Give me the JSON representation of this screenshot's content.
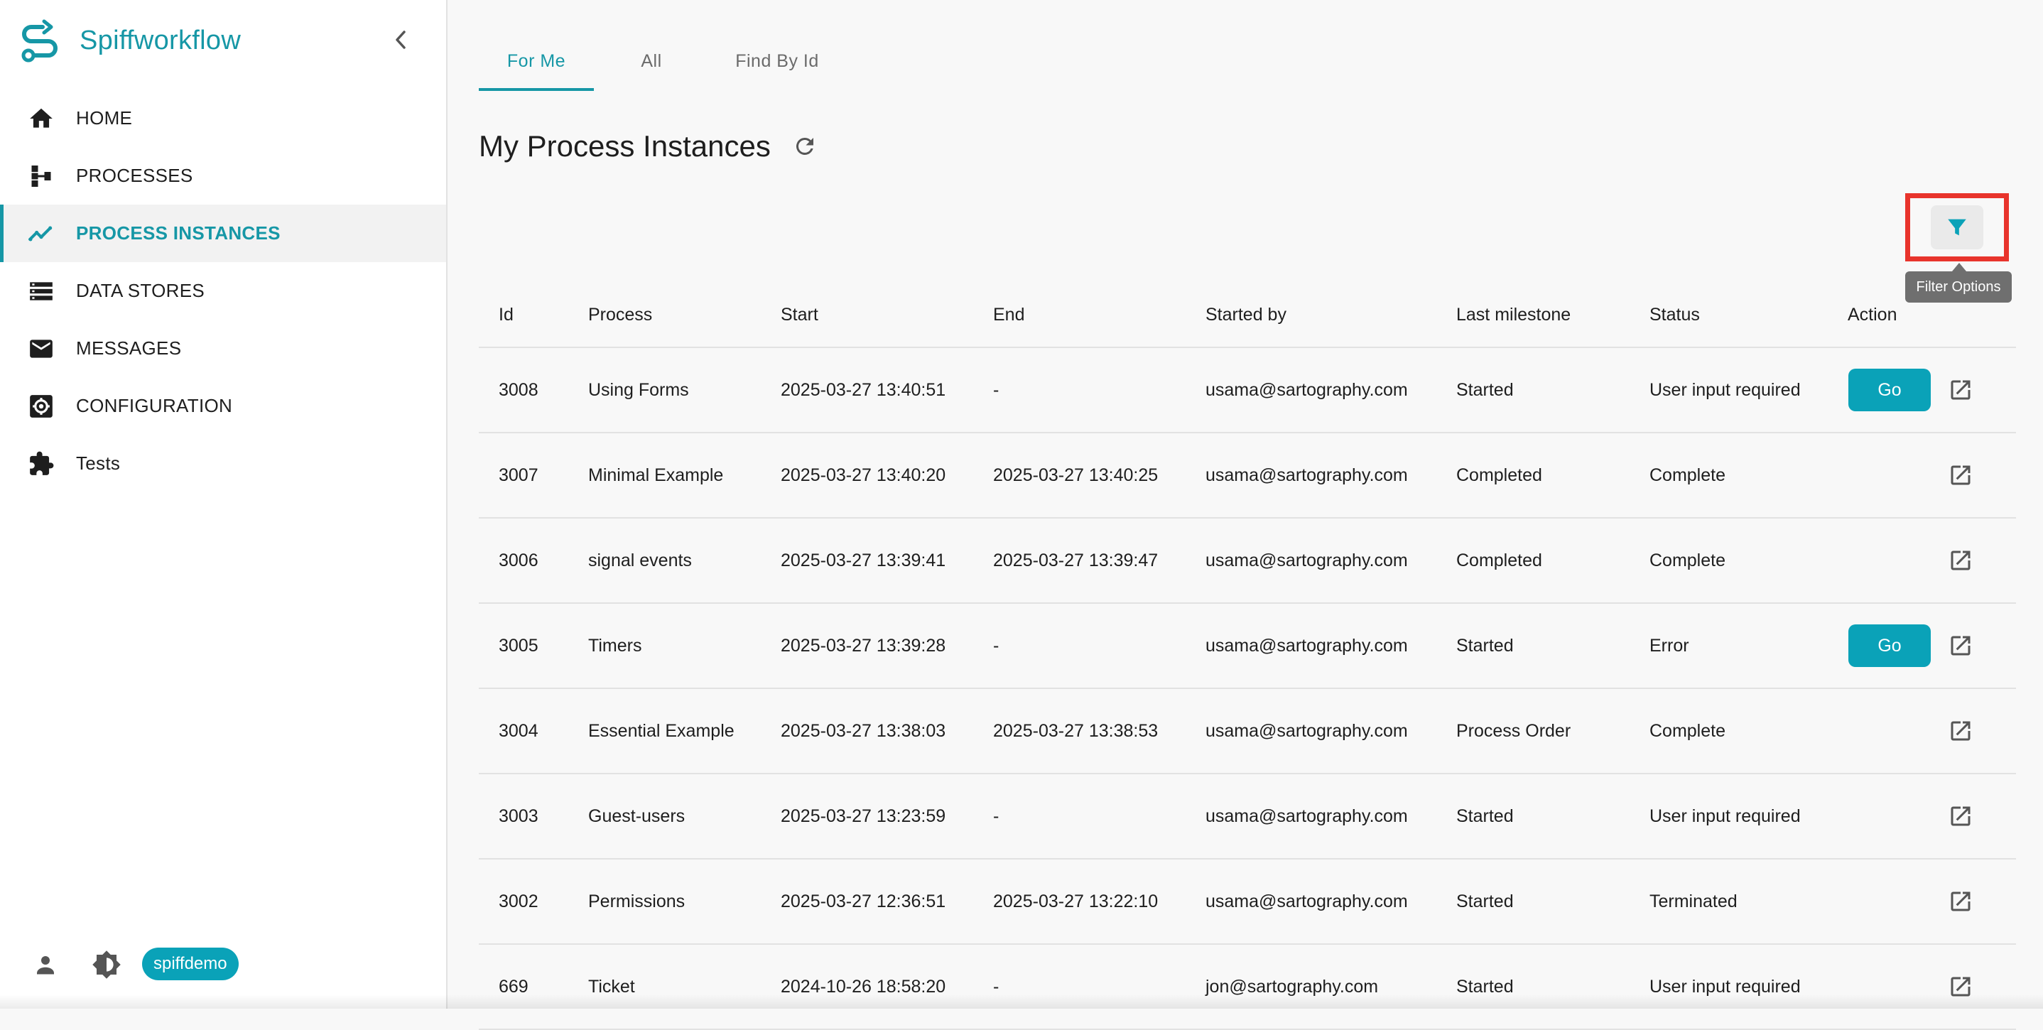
{
  "app": {
    "name": "Spiffworkflow",
    "accent_color": "#1697a6",
    "button_color": "#0aa2b8"
  },
  "sidebar": {
    "items": [
      {
        "label": "HOME",
        "icon": "home-icon",
        "active": false
      },
      {
        "label": "PROCESSES",
        "icon": "process-tree-icon",
        "active": false
      },
      {
        "label": "PROCESS INSTANCES",
        "icon": "trend-line-icon",
        "active": true
      },
      {
        "label": "DATA STORES",
        "icon": "storage-icon",
        "active": false
      },
      {
        "label": "MESSAGES",
        "icon": "mail-icon",
        "active": false
      },
      {
        "label": "CONFIGURATION",
        "icon": "settings-box-icon",
        "active": false
      },
      {
        "label": "Tests",
        "icon": "puzzle-icon",
        "active": false
      }
    ],
    "footer": {
      "user_chip": "spiffdemo"
    }
  },
  "tabs": [
    {
      "label": "For Me",
      "active": true
    },
    {
      "label": "All",
      "active": false
    },
    {
      "label": "Find By Id",
      "active": false
    }
  ],
  "main": {
    "title": "My Process Instances",
    "filter_tooltip": "Filter Options",
    "highlight_color": "#e8342c"
  },
  "table": {
    "headers": [
      "Id",
      "Process",
      "Start",
      "End",
      "Started by",
      "Last milestone",
      "Status",
      "Action"
    ],
    "rows": [
      {
        "id": "3008",
        "process": "Using Forms",
        "start": "2025-03-27 13:40:51",
        "end": "-",
        "started_by": "usama@sartography.com",
        "milestone": "Started",
        "status": "User input required",
        "go": "Go"
      },
      {
        "id": "3007",
        "process": "Minimal Example",
        "start": "2025-03-27 13:40:20",
        "end": "2025-03-27 13:40:25",
        "started_by": "usama@sartography.com",
        "milestone": "Completed",
        "status": "Complete",
        "go": null
      },
      {
        "id": "3006",
        "process": "signal events",
        "start": "2025-03-27 13:39:41",
        "end": "2025-03-27 13:39:47",
        "started_by": "usama@sartography.com",
        "milestone": "Completed",
        "status": "Complete",
        "go": null
      },
      {
        "id": "3005",
        "process": "Timers",
        "start": "2025-03-27 13:39:28",
        "end": "-",
        "started_by": "usama@sartography.com",
        "milestone": "Started",
        "status": "Error",
        "go": "Go"
      },
      {
        "id": "3004",
        "process": "Essential Example",
        "start": "2025-03-27 13:38:03",
        "end": "2025-03-27 13:38:53",
        "started_by": "usama@sartography.com",
        "milestone": "Process Order",
        "status": "Complete",
        "go": null
      },
      {
        "id": "3003",
        "process": "Guest-users",
        "start": "2025-03-27 13:23:59",
        "end": "-",
        "started_by": "usama@sartography.com",
        "milestone": "Started",
        "status": "User input required",
        "go": null
      },
      {
        "id": "3002",
        "process": "Permissions",
        "start": "2025-03-27 12:36:51",
        "end": "2025-03-27 13:22:10",
        "started_by": "usama@sartography.com",
        "milestone": "Started",
        "status": "Terminated",
        "go": null
      },
      {
        "id": "669",
        "process": "Ticket",
        "start": "2024-10-26 18:58:20",
        "end": "-",
        "started_by": "jon@sartography.com",
        "milestone": "Started",
        "status": "User input required",
        "go": null
      }
    ]
  }
}
